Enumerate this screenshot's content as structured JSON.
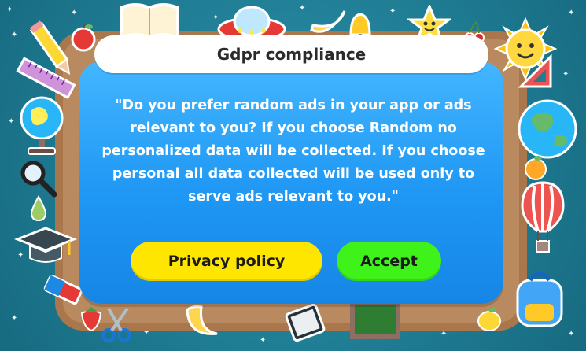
{
  "dialog": {
    "title": "Gdpr compliance",
    "message": "\"Do you prefer random ads in your app or ads relevant to you? If you choose Random no personalized data will be collected. If you choose personal all data collected will be used only to serve ads relevant to you.\"",
    "privacy_button_label": "Privacy policy",
    "accept_button_label": "Accept"
  },
  "colors": {
    "background": "#1f7d94",
    "board": "#b98a5f",
    "dialog": "#1f97f4",
    "title_bar": "#ffffff",
    "privacy_button": "#ffe600",
    "accept_button": "#3ff21a"
  },
  "decorations": [
    "book-icon",
    "apple-icon",
    "rocket-icon",
    "banana-icon",
    "bell-icon",
    "star-character-icon",
    "cherry-icon",
    "sun-icon",
    "pencil-icon",
    "ruler-icon",
    "globe-icon",
    "triangle-ruler-icon",
    "magnifier-icon",
    "earth-icon",
    "pear-icon",
    "orange-icon",
    "graduation-cap-icon",
    "hot-air-balloon-icon",
    "eraser-icon",
    "backpack-icon",
    "strawberry-icon",
    "scissors-icon",
    "moon-icon",
    "tablet-icon",
    "chalkboard-icon",
    "lemon-icon"
  ]
}
